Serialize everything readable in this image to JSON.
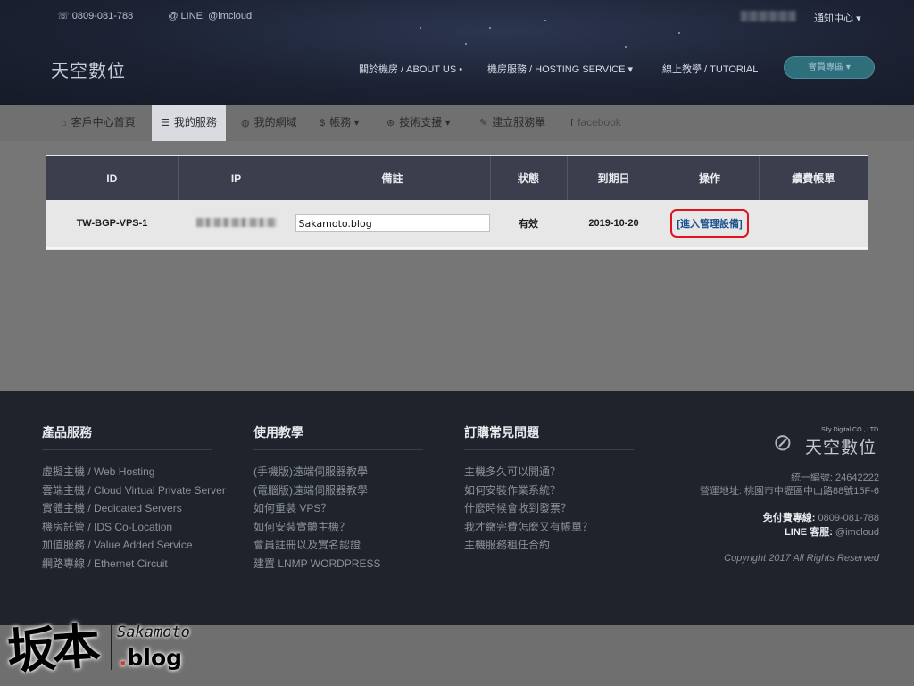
{
  "header": {
    "phone": "0809-081-788",
    "line": "LINE: @imcloud",
    "notify": "通知中心",
    "logo": "天空數位",
    "nav": [
      {
        "label": "關於機房 / ABOUT US"
      },
      {
        "label": "機房服務 / HOSTING SERVICE"
      },
      {
        "label": "線上教學 / TUTORIAL"
      }
    ],
    "member_button": "會員專區"
  },
  "subnav": {
    "items": [
      {
        "label": "客戶中心首頁",
        "icon": "home-icon"
      },
      {
        "label": "我的服務",
        "icon": "server-icon"
      },
      {
        "label": "我的網域",
        "icon": "globe-icon"
      },
      {
        "label": "帳務",
        "icon": "dollar-icon"
      },
      {
        "label": "技術支援",
        "icon": "lifebuoy-icon"
      },
      {
        "label": "建立服務單",
        "icon": "edit-icon"
      },
      {
        "label": "facebook",
        "icon": "facebook-icon"
      }
    ]
  },
  "services_table": {
    "headers": [
      "ID",
      "IP",
      "備註",
      "狀態",
      "到期日",
      "操作",
      "續費帳單"
    ],
    "rows": [
      {
        "id": "TW-BGP-VPS-1",
        "note": "Sakamoto.blog",
        "status": "有效",
        "expiry": "2019-10-20",
        "action": "[進入管理設備]",
        "renewal": ""
      }
    ]
  },
  "footer": {
    "columns": [
      {
        "title": "產品服務",
        "links": [
          "虛擬主機 / Web Hosting",
          "雲端主機 / Cloud Virtual Private Server",
          "實體主機 / Dedicated Servers",
          "機房託管 / IDS Co-Location",
          "加值服務 / Value Added Service",
          "網路專線 / Ethernet Circuit"
        ]
      },
      {
        "title": "使用教學",
        "links": [
          "(手機版)遠端伺服器教學",
          "(電腦版)遠端伺服器教學",
          "如何重裝 VPS？",
          "如何安裝實體主機？",
          "會員註冊以及實名認證",
          "建置 LNMP WORDPRESS"
        ]
      },
      {
        "title": "訂購常見問題",
        "links": [
          "主機多久可以開通？",
          "如何安裝作業系統？",
          "什麼時候會收到發票？",
          "我才繳完費怎麼又有帳單？",
          "主機服務租任合約"
        ]
      }
    ],
    "brand_en": "Sky Digital CO., LTD.",
    "brand_cn": "天空數位",
    "tax_id": "統一編號: 24642222",
    "address": "營運地址: 桃園市中壢區中山路88號15F-6",
    "hotline_label": "免付費專線:",
    "hotline": "0809-081-788",
    "line_label": "LINE 客服:",
    "line_id": "@imcloud",
    "copyright": "Copyright 2017 All Rights Reserved"
  },
  "watermark": {
    "cn": "坂本",
    "en": "Sakamoto",
    "blog_dot": ".",
    "blog": "blog"
  }
}
